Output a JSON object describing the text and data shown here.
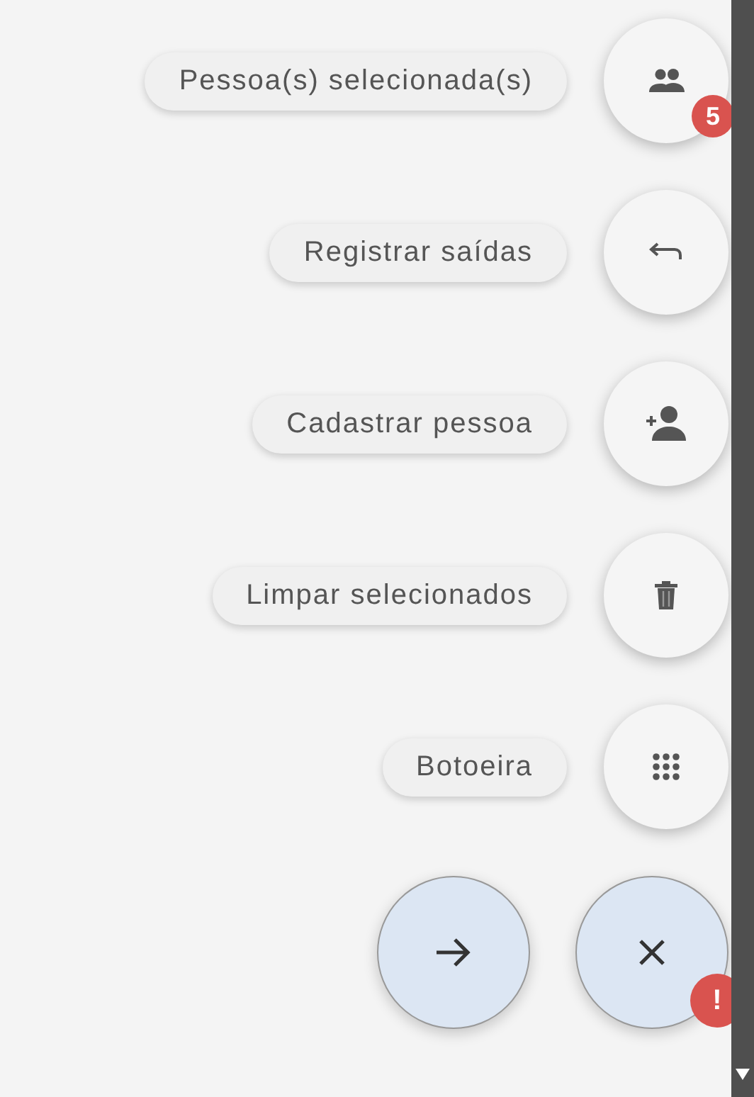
{
  "actions": [
    {
      "label": "Pessoa(s) selecionada(s)",
      "kind": "people",
      "badge": "5"
    },
    {
      "label": "Registrar saídas",
      "kind": "undo"
    },
    {
      "label": "Cadastrar pessoa",
      "kind": "person-add"
    },
    {
      "label": "Limpar selecionados",
      "kind": "trash"
    },
    {
      "label": "Botoeira",
      "kind": "grid"
    }
  ],
  "main_buttons": [
    {
      "kind": "arrow"
    },
    {
      "kind": "close",
      "badge": "!"
    }
  ]
}
